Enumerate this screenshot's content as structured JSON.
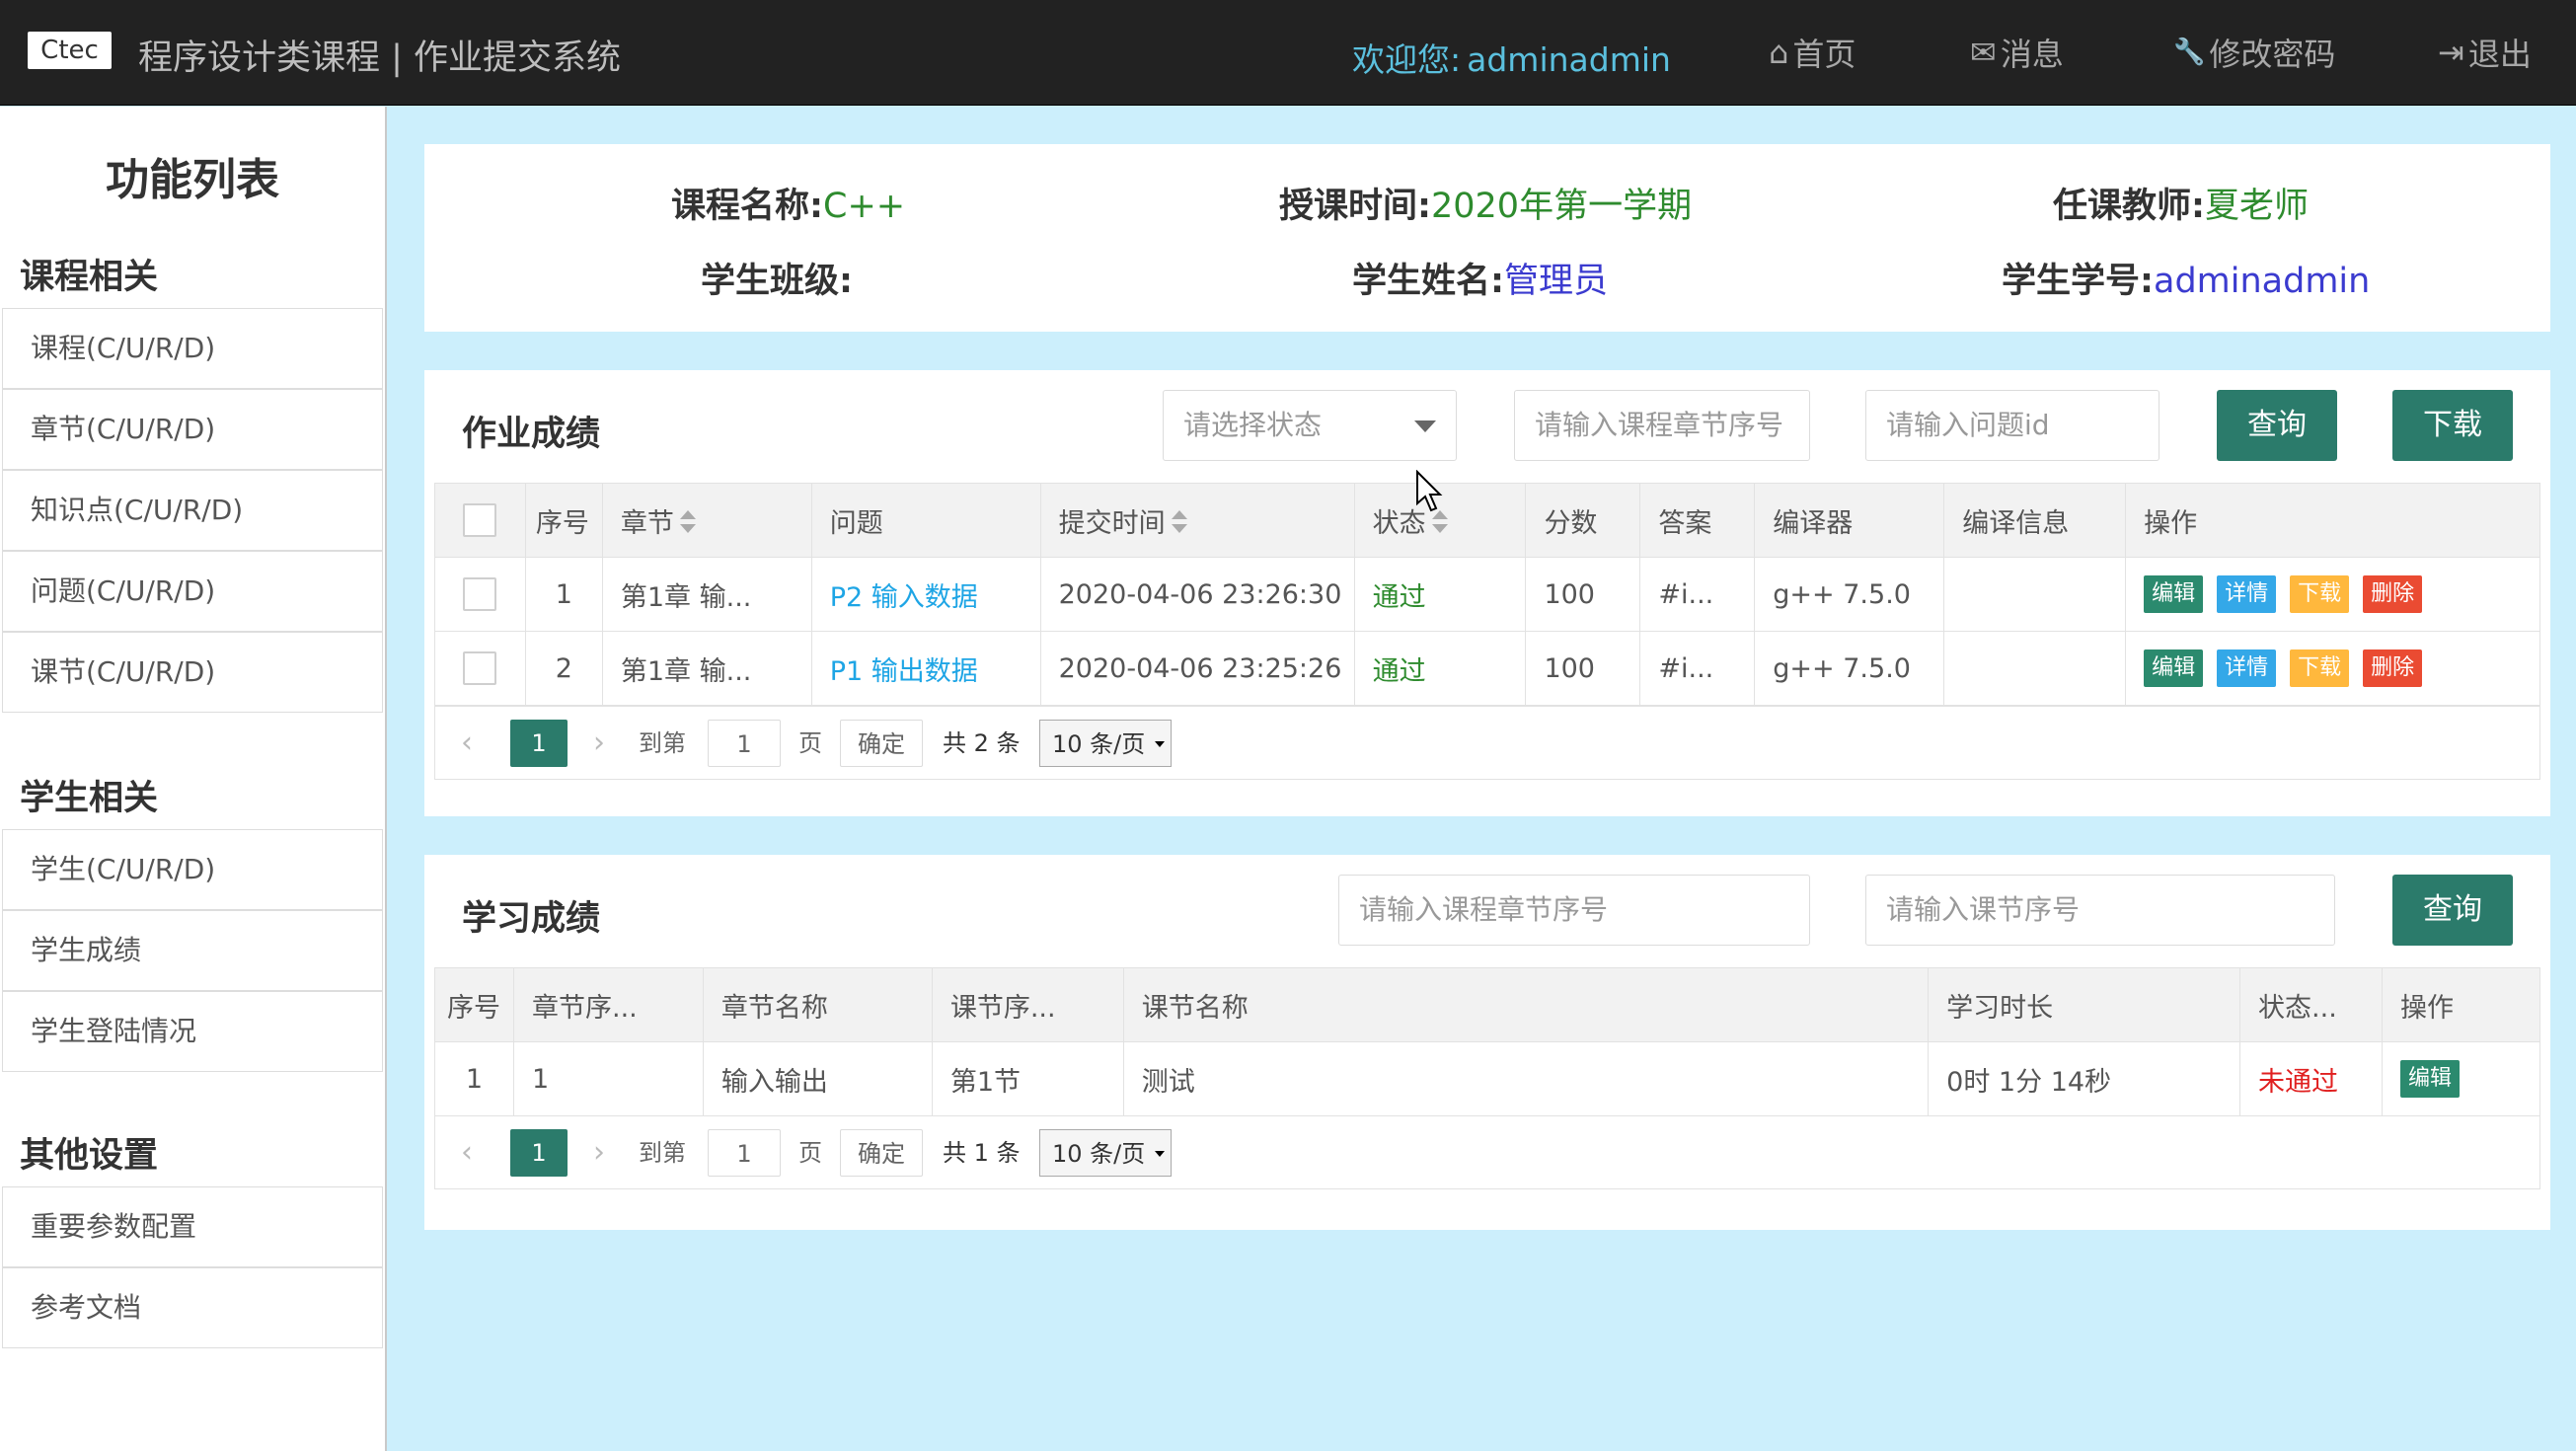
{
  "header": {
    "logo_text": "Ctec",
    "title": "程序设计类课程 | 作业提交系统",
    "welcome_label": "欢迎您:",
    "username": "adminadmin",
    "nav": [
      {
        "icon": "home-icon",
        "glyph": "⌂",
        "label": "首页"
      },
      {
        "icon": "envelope-icon",
        "glyph": "✉",
        "label": "消息"
      },
      {
        "icon": "wrench-icon",
        "glyph": "🔧",
        "label": "修改密码"
      },
      {
        "icon": "logout-icon",
        "glyph": "⇥",
        "label": "退出"
      }
    ]
  },
  "sidebar": {
    "title": "功能列表",
    "sections": [
      {
        "title": "课程相关",
        "items": [
          "课程(C/U/R/D)",
          "章节(C/U/R/D)",
          "知识点(C/U/R/D)",
          "问题(C/U/R/D)",
          "课节(C/U/R/D)"
        ]
      },
      {
        "title": "学生相关",
        "items": [
          "学生(C/U/R/D)",
          "学生成绩",
          "学生登陆情况"
        ]
      },
      {
        "title": "其他设置",
        "items": [
          "重要参数配置",
          "参考文档"
        ]
      }
    ]
  },
  "info": {
    "course_label": "课程名称:",
    "course": "C++",
    "time_label": "授课时间:",
    "time": "2020年第一学期",
    "teacher_label": "任课教师:",
    "teacher": "夏老师",
    "class_label": "学生班级:",
    "class": "",
    "name_label": "学生姓名:",
    "name": "管理员",
    "id_label": "学生学号:",
    "id": "adminadmin"
  },
  "homework": {
    "title": "作业成绩",
    "status_placeholder": "请选择状态",
    "chapter_placeholder": "请输入课程章节序号",
    "question_placeholder": "请输入问题id",
    "query_label": "查询",
    "download_label": "下载",
    "columns": [
      "序号",
      "章节",
      "问题",
      "提交时间",
      "状态",
      "分数",
      "答案",
      "编译器",
      "编译信息",
      "操作"
    ],
    "rows": [
      {
        "no": "1",
        "chapter": "第1章 输...",
        "question": "P2 输入数据",
        "time": "2020-04-06 23:26:30",
        "status": "通过",
        "score": "100",
        "answer": "#i...",
        "compiler": "g++ 7.5.0",
        "info": ""
      },
      {
        "no": "2",
        "chapter": "第1章 输...",
        "question": "P1 输出数据",
        "time": "2020-04-06 23:25:26",
        "status": "通过",
        "score": "100",
        "answer": "#i...",
        "compiler": "g++ 7.5.0",
        "info": ""
      }
    ],
    "actions": [
      "编辑",
      "详情",
      "下载",
      "删除"
    ],
    "pager": {
      "current": "1",
      "goto": "到第",
      "page_input": "1",
      "page": "页",
      "confirm": "确定",
      "total": "共 2 条",
      "per_page": "10 条/页"
    }
  },
  "study": {
    "title": "学习成绩",
    "chapter_placeholder": "请输入课程章节序号",
    "lesson_placeholder": "请输入课节序号",
    "query_label": "查询",
    "columns": [
      "序号",
      "章节序...",
      "章节名称",
      "课节序...",
      "课节名称",
      "学习时长",
      "状态...",
      "操作"
    ],
    "rows": [
      {
        "no": "1",
        "chapter_no": "1",
        "chapter_name": "输入输出",
        "lesson_no": "第1节",
        "lesson_name": "测试",
        "duration": "0时 1分 14秒",
        "status": "未通过",
        "action": "编辑"
      }
    ],
    "pager": {
      "current": "1",
      "goto": "到第",
      "page_input": "1",
      "page": "页",
      "confirm": "确定",
      "total": "共 1 条",
      "per_page": "10 条/页"
    }
  },
  "colors": {
    "topbar": "#222222",
    "accent": "#2b7b6b",
    "background": "#cceffc",
    "link": "#1ea5e5",
    "pass": "#2e8b2e",
    "fail": "#e02020"
  }
}
